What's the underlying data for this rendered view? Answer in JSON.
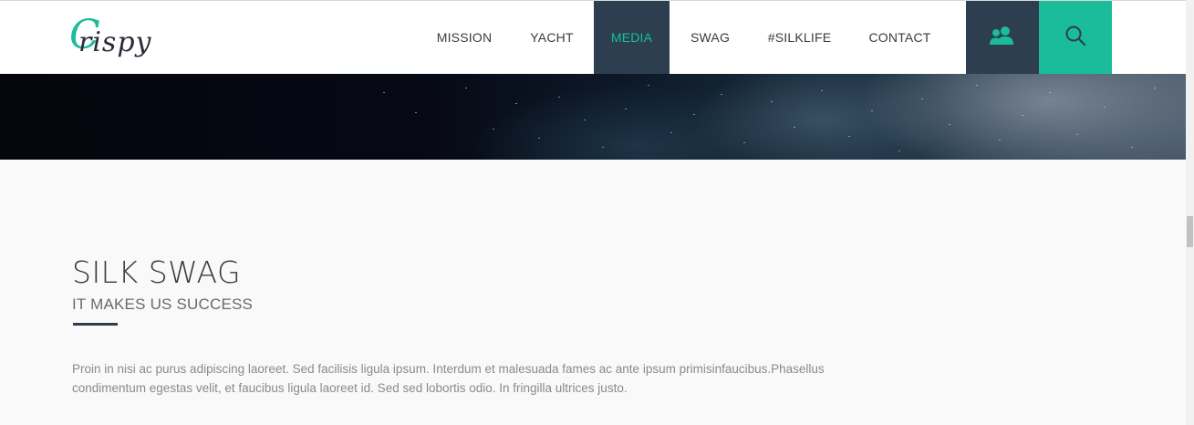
{
  "brand": {
    "logo_text": "rispy",
    "logo_initial": "C"
  },
  "nav": {
    "items": [
      {
        "label": "MISSION"
      },
      {
        "label": "YACHT"
      },
      {
        "label": "MEDIA"
      },
      {
        "label": "SWAG"
      },
      {
        "label": "#SILKLIFE"
      },
      {
        "label": "CONTACT"
      }
    ],
    "active": "MEDIA"
  },
  "icons": {
    "account": "users-icon",
    "search": "search-icon"
  },
  "colors": {
    "accent": "#1abc9c",
    "dark": "#2c3e50"
  },
  "section": {
    "title": "SILK SWAG",
    "subtitle": "IT MAKES US SUCCESS",
    "paragraph": "Proin in nisi ac purus adipiscing laoreet. Sed facilisis ligula ipsum. Interdum et malesuada fames ac ante ipsum primisinfaucibus.Phasellus condimentum egestas velit, et faucibus ligula laoreet id. Sed sed lobortis odio. In fringilla ultrices justo."
  }
}
